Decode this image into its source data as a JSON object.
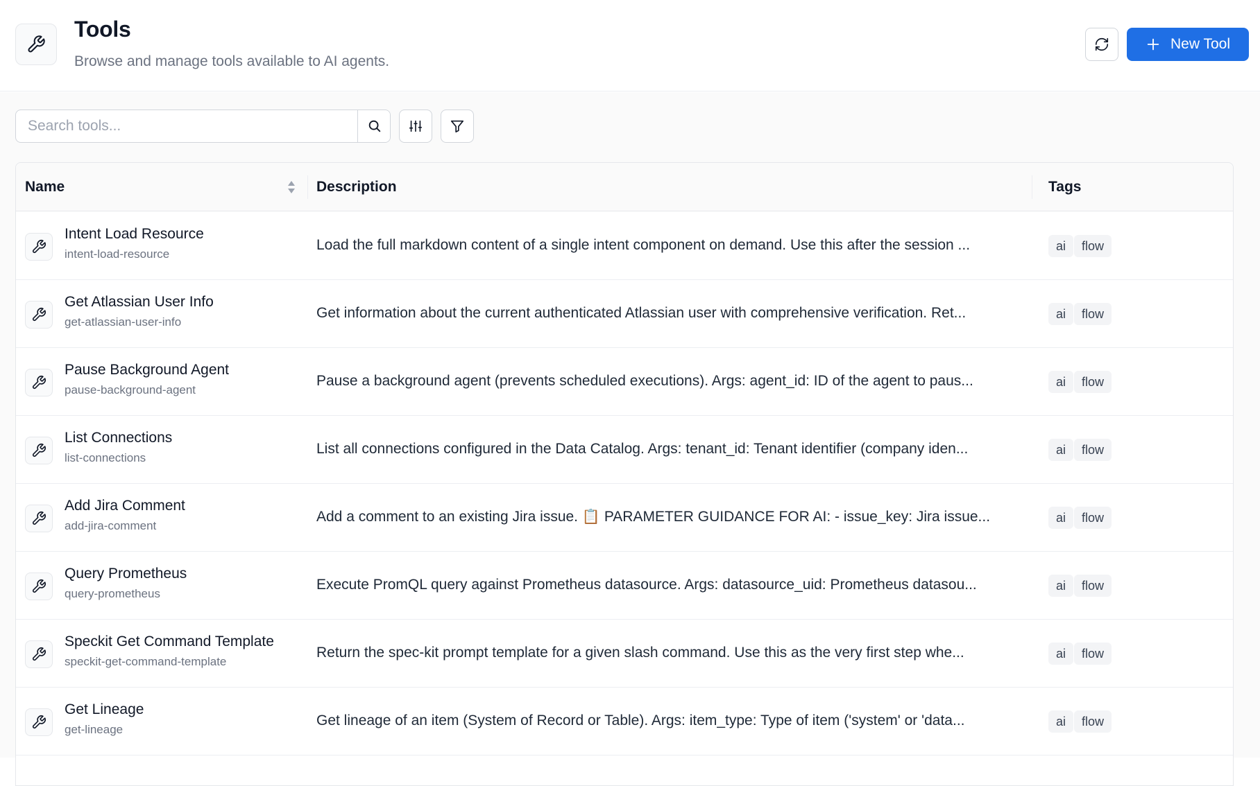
{
  "header": {
    "title": "Tools",
    "subtitle": "Browse and manage tools available to AI agents.",
    "new_tool_label": "New Tool",
    "icon": "wrench-icon"
  },
  "toolbar": {
    "search_placeholder": "Search tools...",
    "search_value": ""
  },
  "table": {
    "columns": {
      "name": "Name",
      "description": "Description",
      "tags": "Tags"
    },
    "rows": [
      {
        "name": "Intent Load Resource",
        "slug": "intent-load-resource",
        "description": "Load the full markdown content of a single intent component on demand. Use this after the session ...",
        "tags": [
          "ai",
          "flow"
        ]
      },
      {
        "name": "Get Atlassian User Info",
        "slug": "get-atlassian-user-info",
        "description": "Get information about the current authenticated Atlassian user with comprehensive verification. Ret...",
        "tags": [
          "ai",
          "flow"
        ]
      },
      {
        "name": "Pause Background Agent",
        "slug": "pause-background-agent",
        "description": "Pause a background agent (prevents scheduled executions). Args: agent_id: ID of the agent to paus...",
        "tags": [
          "ai",
          "flow"
        ]
      },
      {
        "name": "List Connections",
        "slug": "list-connections",
        "description": "List all connections configured in the Data Catalog. Args: tenant_id: Tenant identifier (company iden...",
        "tags": [
          "ai",
          "flow"
        ]
      },
      {
        "name": "Add Jira Comment",
        "slug": "add-jira-comment",
        "description": "Add a comment to an existing Jira issue. 📋 PARAMETER GUIDANCE FOR AI: - issue_key: Jira issue...",
        "tags": [
          "ai",
          "flow"
        ]
      },
      {
        "name": "Query Prometheus",
        "slug": "query-prometheus",
        "description": "Execute PromQL query against Prometheus datasource. Args: datasource_uid: Prometheus datasou...",
        "tags": [
          "ai",
          "flow"
        ]
      },
      {
        "name": "Speckit Get Command Template",
        "slug": "speckit-get-command-template",
        "description": "Return the spec-kit prompt template for a given slash command. Use this as the very first step whe...",
        "tags": [
          "ai",
          "flow"
        ]
      },
      {
        "name": "Get Lineage",
        "slug": "get-lineage",
        "description": "Get lineage of an item (System of Record or Table). Args: item_type: Type of item ('system' or 'data...",
        "tags": [
          "ai",
          "flow"
        ]
      }
    ]
  },
  "colors": {
    "accent": "#1f6fe5",
    "tag_bg": "#f3f4f6",
    "muted_text": "#6b7280"
  }
}
